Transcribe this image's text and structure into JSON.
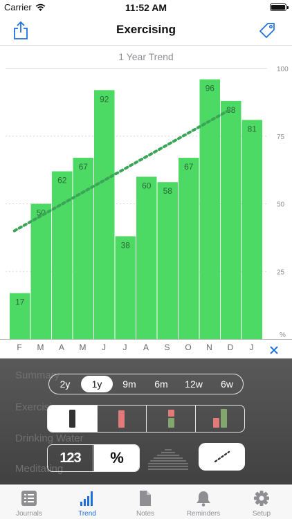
{
  "status": {
    "carrier": "Carrier",
    "time": "11:52 AM"
  },
  "nav": {
    "title": "Exercising"
  },
  "chart_data": {
    "type": "bar",
    "title": "1 Year Trend",
    "categories": [
      "F",
      "M",
      "A",
      "M",
      "J",
      "J",
      "A",
      "S",
      "O",
      "N",
      "D",
      "J"
    ],
    "values": [
      17,
      50,
      62,
      67,
      92,
      38,
      60,
      58,
      67,
      96,
      88,
      81
    ],
    "ylim": [
      0,
      100
    ],
    "yticks": [
      "100",
      "75",
      "50",
      "25"
    ],
    "yunit": "%",
    "trendline": {
      "start": 40,
      "end": 85
    },
    "bar_color": "#4cd964",
    "trend_color": "#3aa457"
  },
  "controls": {
    "background_items": [
      "Summary",
      "Exercising",
      "Drinking Water",
      "Meditating"
    ],
    "periods": [
      "2y",
      "1y",
      "9m",
      "6m",
      "12w",
      "6w"
    ],
    "active_period": "1y",
    "format_numbers": "123",
    "format_percent": "%"
  },
  "tabs": [
    {
      "label": "Journals",
      "icon": "list-icon"
    },
    {
      "label": "Trend",
      "icon": "bars-icon"
    },
    {
      "label": "Notes",
      "icon": "note-icon"
    },
    {
      "label": "Reminders",
      "icon": "bell-icon"
    },
    {
      "label": "Setup",
      "icon": "gear-icon"
    }
  ],
  "active_tab": "Trend"
}
